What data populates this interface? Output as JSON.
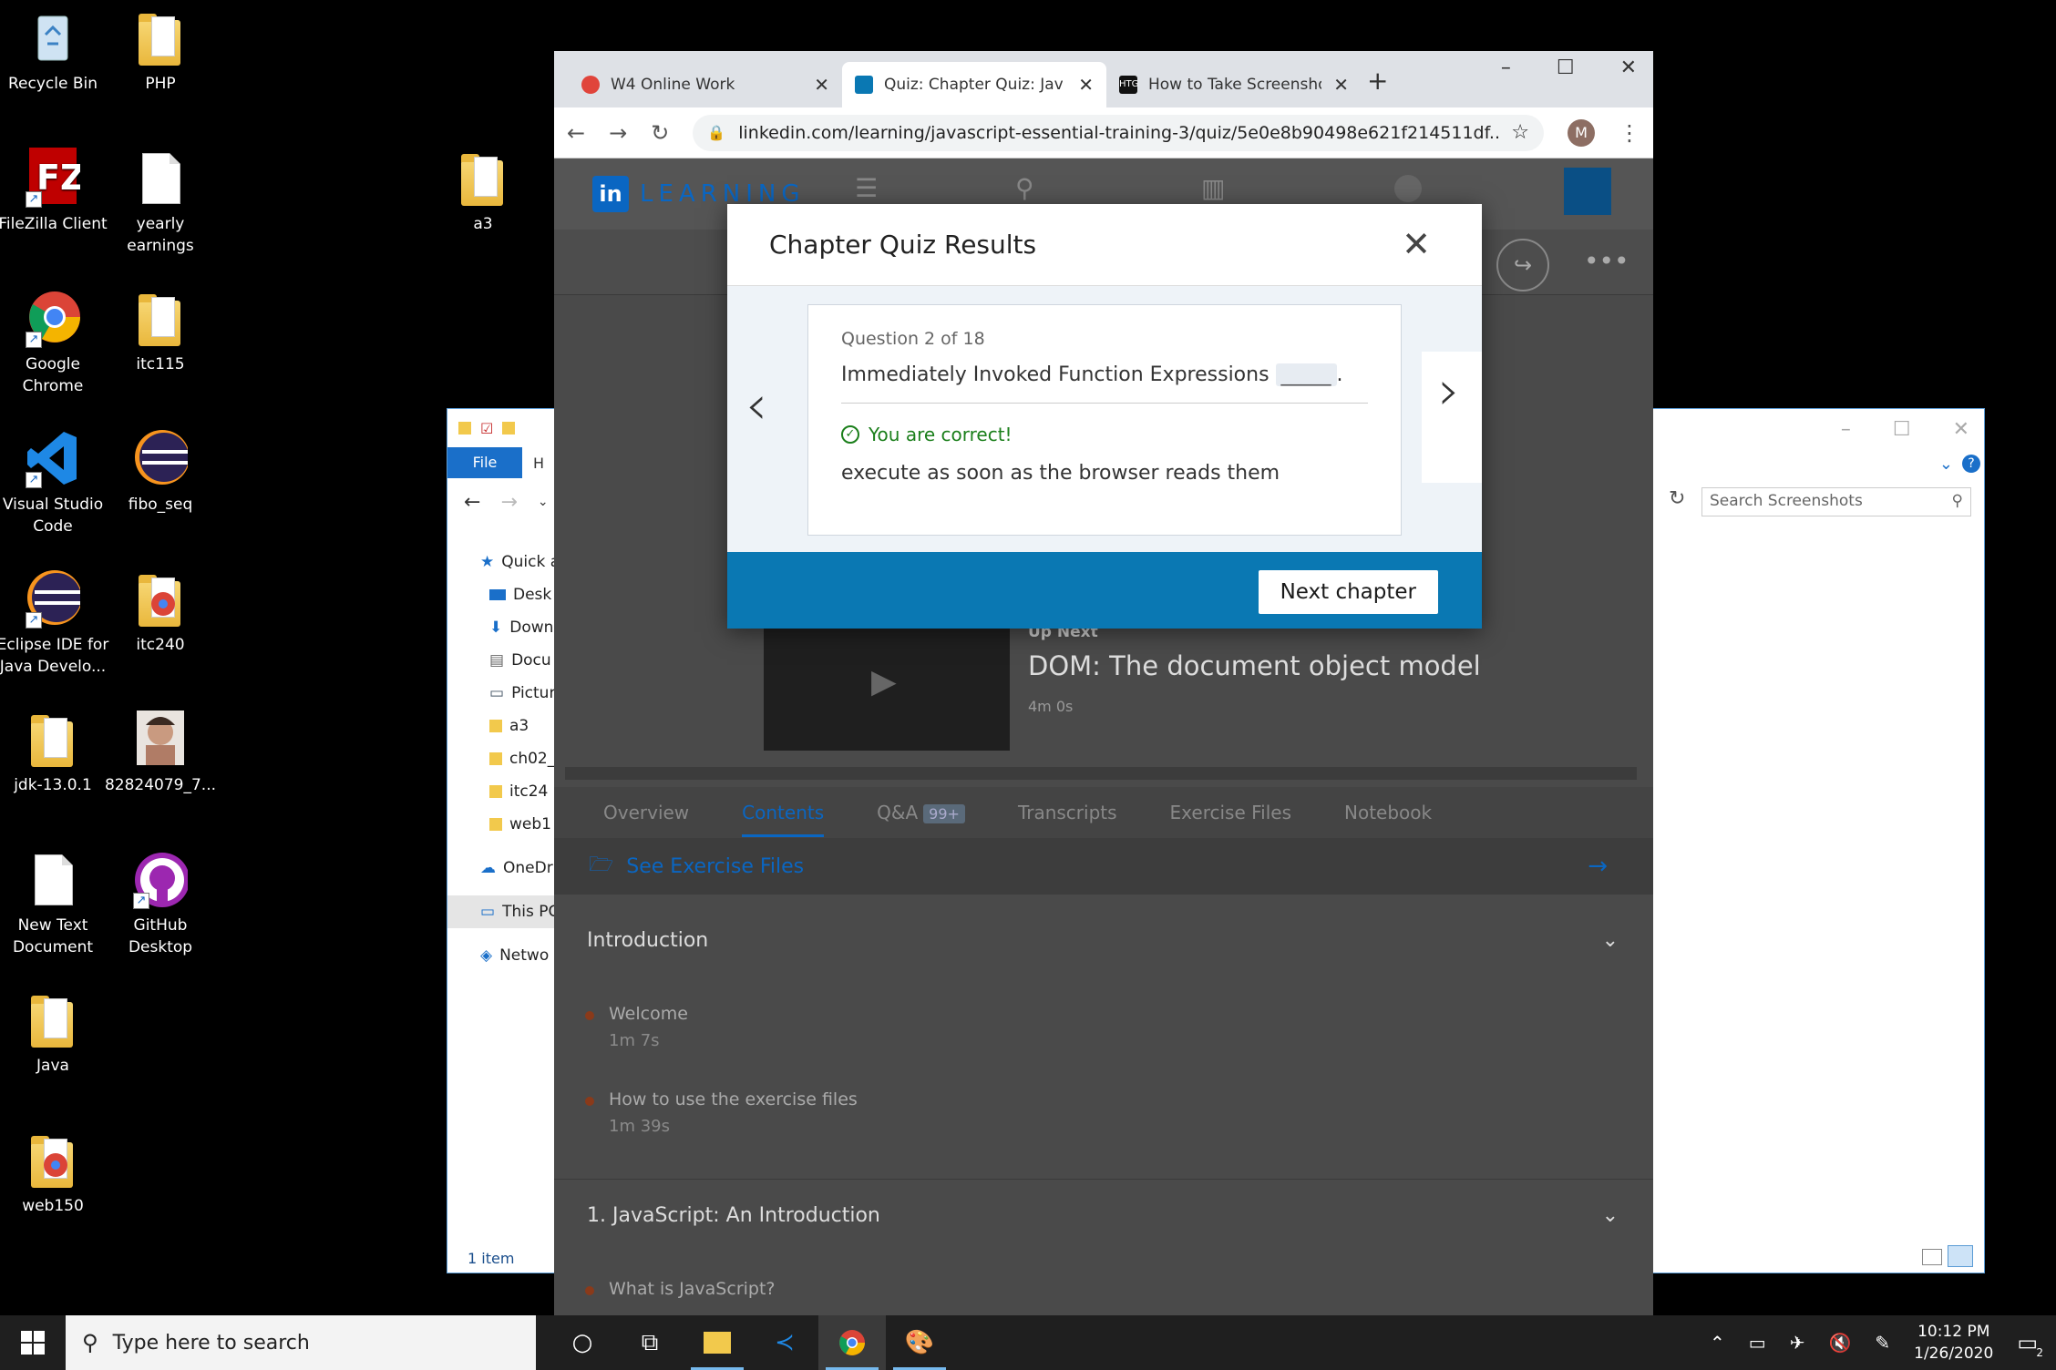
{
  "desktop": {
    "icons": [
      {
        "label": "Recycle Bin",
        "icon": "recycle-bin-icon"
      },
      {
        "label": "PHP",
        "icon": "folder-icon"
      },
      {
        "label": "FileZilla Client",
        "icon": "filezilla-icon"
      },
      {
        "label": "yearly earnings",
        "icon": "text-document-icon"
      },
      {
        "label": "a3",
        "icon": "folder-icon"
      },
      {
        "label": "Google Chrome",
        "icon": "chrome-icon"
      },
      {
        "label": "itc115",
        "icon": "folder-icon"
      },
      {
        "label": "Visual Studio Code",
        "icon": "vscode-icon"
      },
      {
        "label": "fibo_seq",
        "icon": "eclipse-icon"
      },
      {
        "label": "Eclipse IDE for Java Develo...",
        "icon": "eclipse-icon"
      },
      {
        "label": "itc240",
        "icon": "chrome-folder-icon"
      },
      {
        "label": "jdk-13.0.1",
        "icon": "folder-icon"
      },
      {
        "label": "82824079_7...",
        "icon": "photo-icon"
      },
      {
        "label": "New Text Document",
        "icon": "text-document-icon"
      },
      {
        "label": "GitHub Desktop",
        "icon": "github-icon"
      },
      {
        "label": "Java",
        "icon": "folder-icon"
      },
      {
        "label": "web150",
        "icon": "chrome-folder-icon"
      }
    ]
  },
  "explorer": {
    "ribbon_file": "File",
    "ribbon_home": "H",
    "sidebar": [
      "Quick a",
      "Desk",
      "Down",
      "Docu",
      "Pictur",
      "a3",
      "ch02_",
      "itc24",
      "web1",
      "OneDr",
      "This PC",
      "Netwo"
    ],
    "status": "1 item",
    "search_placeholder": "Search Screenshots"
  },
  "browser": {
    "tabs": [
      {
        "title": "W4 Online Work",
        "color": "#e0443b"
      },
      {
        "title": "Quiz: Chapter Quiz: Java",
        "color": "#0a78b3"
      },
      {
        "title": "How to Take Screensho",
        "color": "#111111"
      }
    ],
    "url": "linkedin.com/learning/javascript-essential-training-3/quiz/5e0e8b90498e621f214511df...",
    "avatar_letter": "M"
  },
  "page": {
    "brand": "LEARNING",
    "up_next_label": "Up Next",
    "up_next_title": "DOM: The document object model",
    "up_next_duration": "4m 0s",
    "tabs": [
      "Overview",
      "Contents",
      "Q&A",
      "Transcripts",
      "Exercise Files",
      "Notebook"
    ],
    "qa_badge": "99+",
    "exercise_files_link": "See Exercise Files",
    "sections": [
      {
        "title": "Introduction",
        "lessons": [
          {
            "title": "Welcome",
            "duration": "1m 7s"
          },
          {
            "title": "How to use the exercise files",
            "duration": "1m 39s"
          }
        ]
      },
      {
        "title": "1. JavaScript: An Introduction",
        "lessons": [
          {
            "title": "What is JavaScript?",
            "duration": ""
          }
        ]
      }
    ]
  },
  "modal": {
    "title": "Chapter Quiz Results",
    "question_number": "Question 2 of 18",
    "question_text": "Immediately Invoked Function Expressions",
    "blank": "_____",
    "result": "You are correct!",
    "answer": "execute as soon as the browser reads them",
    "next_button": "Next chapter"
  },
  "taskbar": {
    "search_placeholder": "Type here to search",
    "time": "10:12 PM",
    "date": "1/26/2020",
    "notification_count": "2"
  }
}
